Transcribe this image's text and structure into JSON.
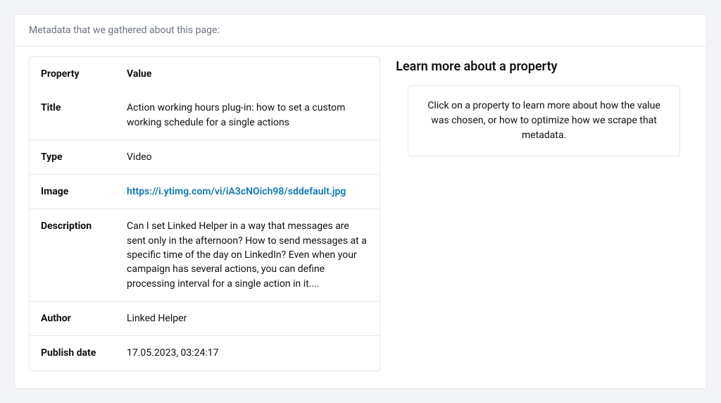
{
  "header": {
    "intro": "Metadata that we gathered about this page:"
  },
  "table": {
    "columns": {
      "property": "Property",
      "value": "Value"
    },
    "rows": {
      "title": {
        "label": "Title",
        "value": "Action working hours plug-in: how to set a custom working schedule for a single actions"
      },
      "type": {
        "label": "Type",
        "value": "Video"
      },
      "image": {
        "label": "Image",
        "value": "https://i.ytimg.com/vi/iA3cNOich98/sddefault.jpg"
      },
      "description": {
        "label": "Description",
        "value": "Can I set Linked Helper in a way that messages are sent only in the afternoon? How to send messages at a specific time of the day on LinkedIn? Even when your campaign has several actions, you can define processing interval for a single action in it...."
      },
      "author": {
        "label": "Author",
        "value": "Linked Helper"
      },
      "publish": {
        "label": "Publish date",
        "value": "17.05.2023, 03:24:17"
      }
    }
  },
  "sidebar": {
    "title": "Learn more about a property",
    "hint": "Click on a property to learn more about how the value was chosen, or how to optimize how we scrape that metadata."
  }
}
